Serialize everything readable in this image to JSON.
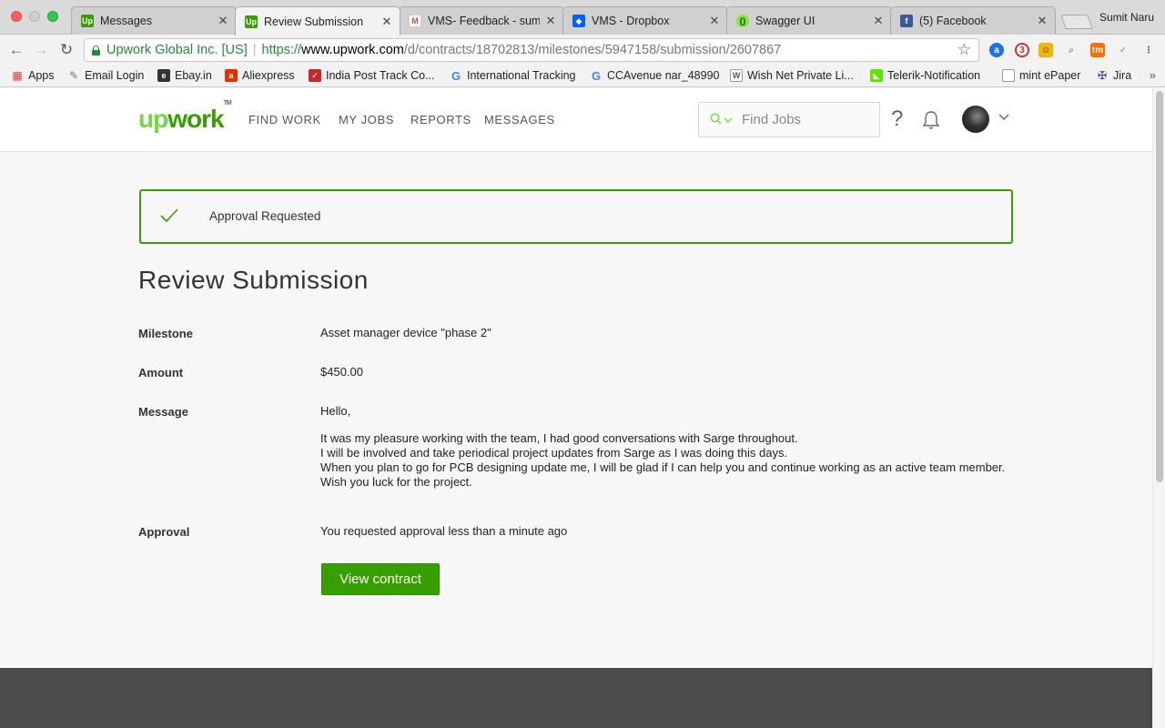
{
  "browser": {
    "tabs": [
      {
        "title": "Messages",
        "favicon": "upwork-icon",
        "color": "#37a000",
        "active": false
      },
      {
        "title": "Review Submission",
        "favicon": "upwork-icon",
        "color": "#37a000",
        "active": true
      },
      {
        "title": "VMS- Feedback - sum",
        "favicon": "gmail-icon",
        "color": "#d44638",
        "active": false
      },
      {
        "title": "VMS - Dropbox",
        "favicon": "dropbox-icon",
        "color": "#0061fe",
        "active": false
      },
      {
        "title": "Swagger UI",
        "favicon": "swagger-icon",
        "color": "#85ea2d",
        "active": false
      },
      {
        "title": "(5) Facebook",
        "favicon": "facebook-icon",
        "color": "#3b5998",
        "active": false
      }
    ],
    "profile_name": "Sumit Naru",
    "address": {
      "secure_label": "Upwork Global Inc. [US]",
      "url_proto": "https://",
      "url_host": "www.upwork.com",
      "url_path": "/d/contracts/18702813/milestones/5947158/submission/2607867"
    },
    "bookmarks": [
      {
        "label": "Apps",
        "icon": "apps-grid-icon"
      },
      {
        "label": "Email Login",
        "icon": "email-login-icon"
      },
      {
        "label": "Ebay.in",
        "icon": "ebay-icon"
      },
      {
        "label": "Aliexpress",
        "icon": "aliexpress-icon"
      },
      {
        "label": "India Post Track Co...",
        "icon": "india-post-icon"
      },
      {
        "label": "International Tracking",
        "icon": "google-icon"
      },
      {
        "label": "CCAvenue nar_48990",
        "icon": "google-icon"
      },
      {
        "label": "Wish Net Private Li...",
        "icon": "wishnet-icon"
      },
      {
        "label": "Telerik-Notification",
        "icon": "telerik-icon"
      },
      {
        "label": "mint ePaper",
        "icon": "document-icon"
      },
      {
        "label": "Jira",
        "icon": "jira-icon"
      }
    ],
    "bookmarks_more": "»"
  },
  "site": {
    "logo_up": "up",
    "logo_work": "work",
    "logo_tm": "TM",
    "nav": [
      "FIND WORK",
      "MY JOBS",
      "REPORTS",
      "MESSAGES"
    ],
    "search_placeholder": "Find Jobs",
    "help_glyph": "?"
  },
  "alert": {
    "text": "Approval Requested"
  },
  "page_title": "Review Submission",
  "details": {
    "milestone_label": "Milestone",
    "milestone_value": "Asset manager device \"phase 2\"",
    "amount_label": "Amount",
    "amount_value": "$450.00",
    "message_label": "Message",
    "message_greeting": "Hello,",
    "message_lines": [
      "It was my pleasure working with the team, I had good conversations with Sarge throughout.",
      "I will be involved and take periodical project updates from Sarge as I was doing this days.",
      "When you plan to go for PCB designing update me, I will be glad if I can help you and continue working as an active team member.",
      "Wish you luck for the project."
    ],
    "approval_label": "Approval",
    "approval_value": "You requested approval less than a minute ago"
  },
  "actions": {
    "view_contract": "View contract"
  },
  "colors": {
    "brand_green": "#37a000",
    "brand_light_green": "#6fda44",
    "footer": "#4b4b4b"
  }
}
